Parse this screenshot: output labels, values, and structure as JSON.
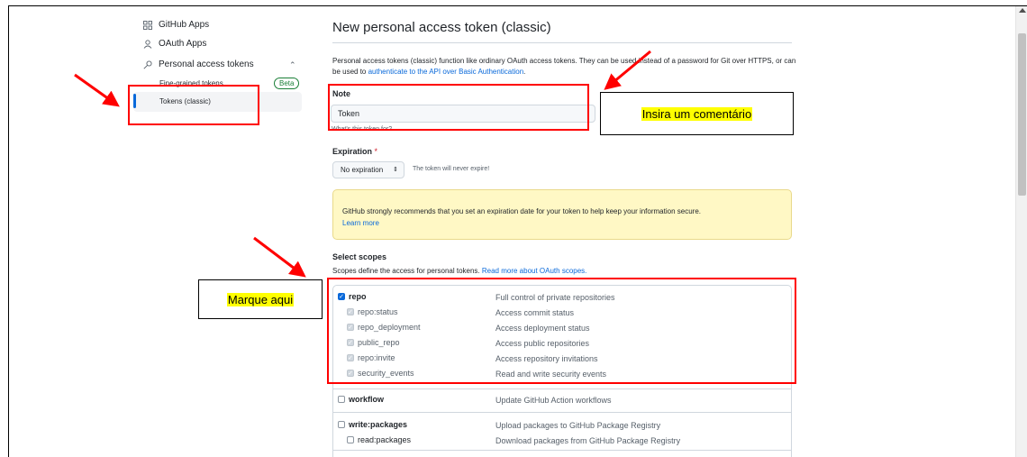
{
  "sidebar": {
    "items": [
      {
        "label": "GitHub Apps",
        "icon": "apps-grid-icon"
      },
      {
        "label": "OAuth Apps",
        "icon": "person-icon"
      },
      {
        "label": "Personal access tokens",
        "icon": "key-icon"
      }
    ],
    "sub_items": [
      {
        "label": "Fine-grained tokens",
        "badge": "Beta"
      },
      {
        "label": "Tokens (classic)",
        "active": true
      }
    ]
  },
  "main": {
    "title": "New personal access token (classic)",
    "intro_before": "Personal access tokens (classic) function like ordinary OAuth access tokens. They can be used instead of a password for Git over HTTPS, or can be used to ",
    "intro_link": "authenticate to the API over Basic Authentication",
    "intro_after": ".",
    "note_label": "Note",
    "note_value": "Token",
    "note_hint": "What's this token for?",
    "expiration_label": "Expiration",
    "expiration_required": "*",
    "expiration_value": "No expiration",
    "expiration_note": "The token will never expire!",
    "warning_text": "GitHub strongly recommends that you set an expiration date for your token to help keep your information secure.",
    "warning_link": "Learn more",
    "scopes_label": "Select scopes",
    "scopes_sub": "Scopes define the access for personal tokens. ",
    "scopes_link": "Read more about OAuth scopes.",
    "scopes": [
      {
        "name": "repo",
        "desc": "Full control of private repositories",
        "checked": true,
        "parent": true
      },
      {
        "name": "repo:status",
        "desc": "Access commit status",
        "checked": true,
        "parent": false
      },
      {
        "name": "repo_deployment",
        "desc": "Access deployment status",
        "checked": true,
        "parent": false
      },
      {
        "name": "public_repo",
        "desc": "Access public repositories",
        "checked": true,
        "parent": false
      },
      {
        "name": "repo:invite",
        "desc": "Access repository invitations",
        "checked": true,
        "parent": false
      },
      {
        "name": "security_events",
        "desc": "Read and write security events",
        "checked": true,
        "parent": false
      },
      {
        "name": "workflow",
        "desc": "Update GitHub Action workflows",
        "checked": false,
        "parent": true
      },
      {
        "name": "write:packages",
        "desc": "Upload packages to GitHub Package Registry",
        "checked": false,
        "parent": true
      },
      {
        "name": "read:packages",
        "desc": "Download packages from GitHub Package Registry",
        "checked": false,
        "parent": false
      }
    ]
  },
  "annotations": {
    "comment_label": "Insira um comentário",
    "mark_label": "Marque aqui",
    "color": "#ff0000"
  },
  "colors": {
    "link": "#0969da",
    "warning_bg": "#fff8c5",
    "highlight": "#ffff00"
  }
}
